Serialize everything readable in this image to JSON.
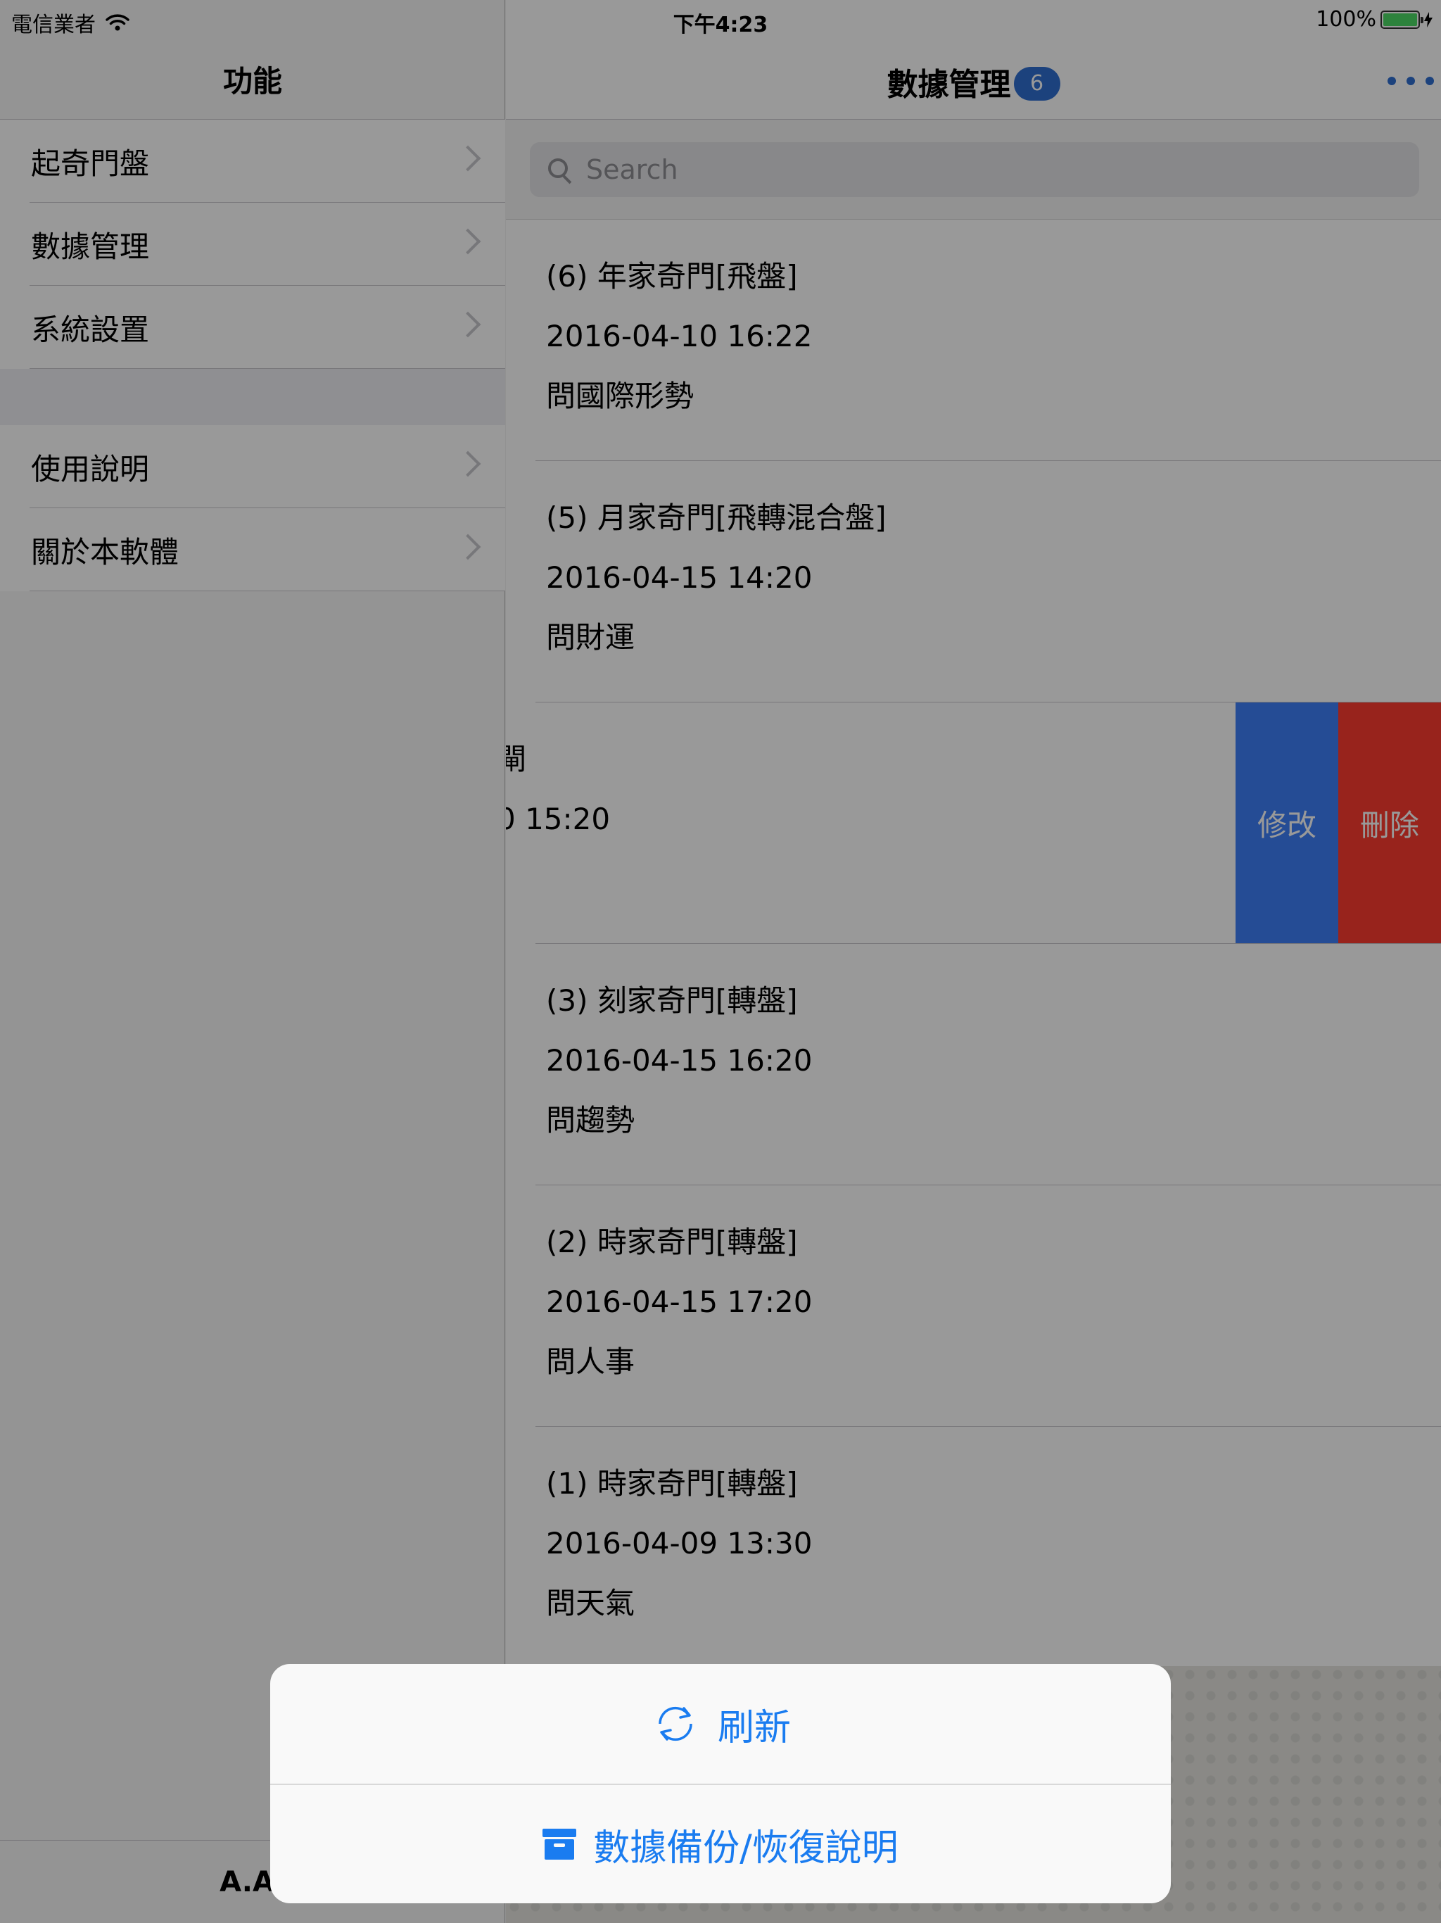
{
  "status_bar": {
    "carrier": "電信業者",
    "time": "下午4:23",
    "battery": "100%",
    "battery_level": 1.0
  },
  "master": {
    "title": "功能",
    "group1": [
      {
        "label": "起奇門盤"
      },
      {
        "label": "數據管理"
      },
      {
        "label": "系統設置"
      }
    ],
    "group2": [
      {
        "label": "使用說明"
      },
      {
        "label": "關於本軟體"
      }
    ],
    "footer": "A.A."
  },
  "detail": {
    "title": "數據管理",
    "badge": "6",
    "search": {
      "placeholder": "Search",
      "value": ""
    },
    "records": [
      {
        "title": "(6) 年家奇門[飛盤]",
        "datetime": "2016-04-10 16:22",
        "question": "問國際形勢"
      },
      {
        "title": "(5) 月家奇門[飛轉混合盤]",
        "datetime": "2016-04-15 14:20",
        "question": "問財運"
      },
      {
        "title": "閘",
        "datetime": "0 15:20",
        "question": ""
      },
      {
        "title": "(3) 刻家奇門[轉盤]",
        "datetime": "2016-04-15 16:20",
        "question": "問趨勢"
      },
      {
        "title": "(2) 時家奇門[轉盤]",
        "datetime": "2016-04-15 17:20",
        "question": "問人事"
      },
      {
        "title": "(1) 時家奇門[轉盤]",
        "datetime": "2016-04-09 13:30",
        "question": "問天氣"
      }
    ],
    "swipe_actions": {
      "edit": "修改",
      "delete": "刪除"
    }
  },
  "action_sheet": {
    "refresh": "刷新",
    "backup": "數據備份/恢復說明"
  },
  "colors": {
    "accent": "#1a7cf0",
    "badge": "#2f6fd1",
    "edit": "#3f7ff9",
    "delete": "#fd3b2f"
  }
}
